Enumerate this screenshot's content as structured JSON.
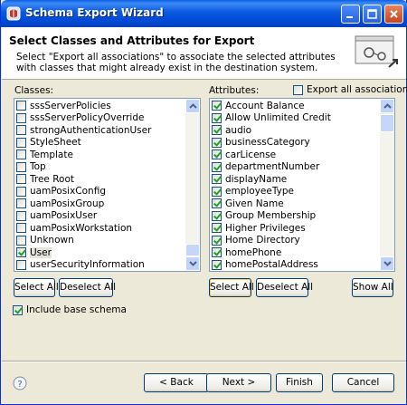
{
  "window": {
    "title": "Schema Export Wizard"
  },
  "header": {
    "title": "Select Classes and Attributes for Export",
    "description": "Select \"Export all associations\" to associate the selected attributes with classes that might already exist in the destination system."
  },
  "classes": {
    "label": "Classes:",
    "items": [
      {
        "label": "sssServerPolicies",
        "checked": false
      },
      {
        "label": "sssServerPolicyOverride",
        "checked": false
      },
      {
        "label": "strongAuthenticationUser",
        "checked": false
      },
      {
        "label": "StyleSheet",
        "checked": false
      },
      {
        "label": "Template",
        "checked": false
      },
      {
        "label": "Top",
        "checked": false
      },
      {
        "label": "Tree Root",
        "checked": false
      },
      {
        "label": "uamPosixConfig",
        "checked": false
      },
      {
        "label": "uamPosixGroup",
        "checked": false
      },
      {
        "label": "uamPosixUser",
        "checked": false
      },
      {
        "label": "uamPosixWorkstation",
        "checked": false
      },
      {
        "label": "Unknown",
        "checked": false
      },
      {
        "label": "User",
        "checked": true,
        "selected": true
      },
      {
        "label": "userSecurityInformation",
        "checked": false
      }
    ],
    "select_all_label": "Select All",
    "deselect_all_label": "Deselect All"
  },
  "attributes": {
    "label": "Attributes:",
    "export_all_label": "Export all associations",
    "export_all_checked": false,
    "items": [
      {
        "label": "Account Balance",
        "checked": true
      },
      {
        "label": "Allow Unlimited Credit",
        "checked": true
      },
      {
        "label": "audio",
        "checked": true
      },
      {
        "label": "businessCategory",
        "checked": true
      },
      {
        "label": "carLicense",
        "checked": true
      },
      {
        "label": "departmentNumber",
        "checked": true
      },
      {
        "label": "displayName",
        "checked": true
      },
      {
        "label": "employeeType",
        "checked": true
      },
      {
        "label": "Given Name",
        "checked": true
      },
      {
        "label": "Group Membership",
        "checked": true
      },
      {
        "label": "Higher Privileges",
        "checked": true
      },
      {
        "label": "Home Directory",
        "checked": true
      },
      {
        "label": "homePhone",
        "checked": true
      },
      {
        "label": "homePostalAddress",
        "checked": true
      }
    ],
    "select_all_label": "Select All",
    "deselect_all_label": "Deselect All",
    "show_all_label": "Show All"
  },
  "include_base_schema": {
    "label": "Include base schema",
    "checked": true
  },
  "footer": {
    "back_label": "< Back",
    "next_label": "Next >",
    "finish_label": "Finish",
    "cancel_label": "Cancel"
  },
  "colors": {
    "titlebar": "#0a58e0",
    "dialog_bg": "#ece9d8",
    "check": "#21a121",
    "list_border": "#7f9db9"
  }
}
